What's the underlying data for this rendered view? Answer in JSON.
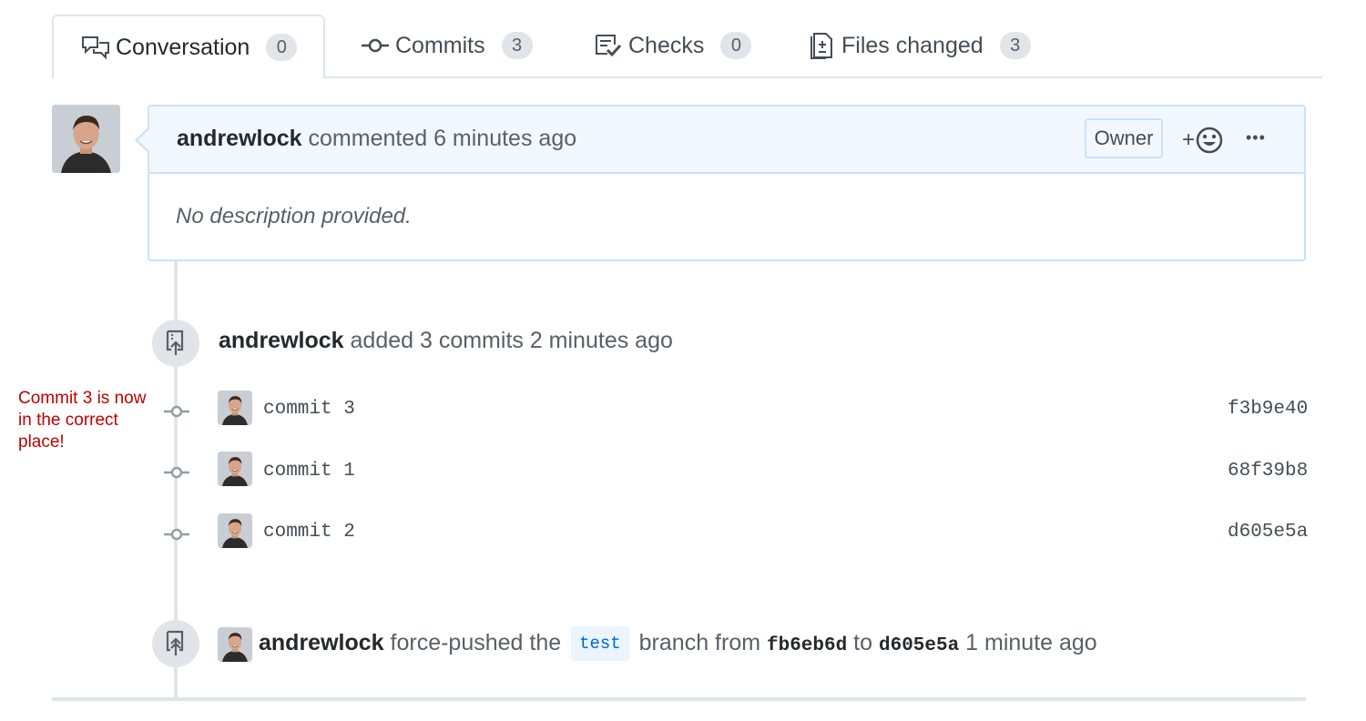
{
  "tabs": [
    {
      "label": "Conversation",
      "count": "0",
      "icon": "comment-discussion-icon"
    },
    {
      "label": "Commits",
      "count": "3",
      "icon": "git-commit-icon"
    },
    {
      "label": "Checks",
      "count": "0",
      "icon": "checklist-icon"
    },
    {
      "label": "Files changed",
      "count": "3",
      "icon": "diff-icon"
    }
  ],
  "comment": {
    "author": "andrewlock",
    "action": "commented 6 minutes ago",
    "badge": "Owner",
    "reaction_plus": "+",
    "more": "•••",
    "body": "No description provided."
  },
  "commits_event": {
    "author": "andrewlock",
    "action": "added 3 commits 2 minutes ago",
    "commits": [
      {
        "message": "commit 3",
        "sha": "f3b9e40"
      },
      {
        "message": "commit 1",
        "sha": "68f39b8"
      },
      {
        "message": "commit 2",
        "sha": "d605e5a"
      }
    ]
  },
  "force_push": {
    "author": "andrewlock",
    "text1": "force-pushed the",
    "branch": "test",
    "text2": "branch from",
    "from_sha": "fb6eb6d",
    "text3": "to",
    "to_sha": "d605e5a",
    "time": "1 minute ago"
  },
  "annotation": "Commit 3 is now in the correct place!",
  "colors": {
    "accent_border": "#c8e1ff",
    "header_bg": "#f1f8ff",
    "annotation": "#c00000"
  }
}
